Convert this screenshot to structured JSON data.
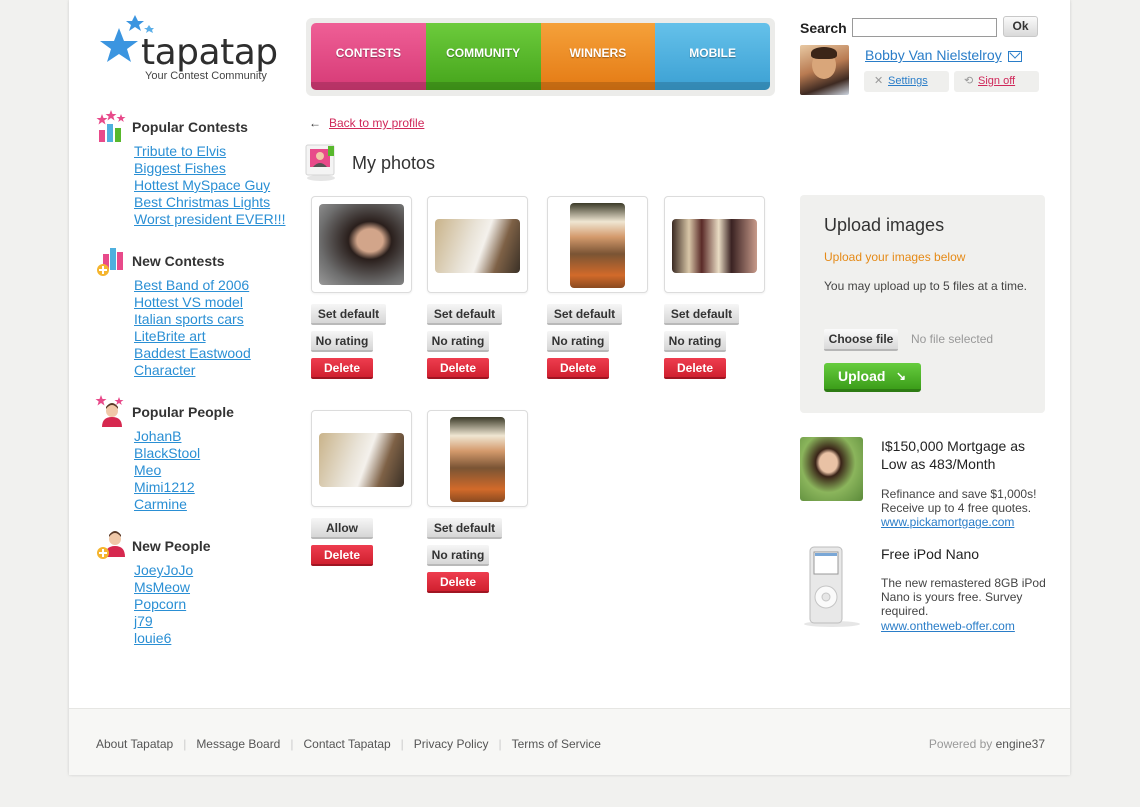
{
  "logo": {
    "word": "tapatap",
    "tagline": "Your Contest Community"
  },
  "nav": [
    {
      "label": "CONTESTS"
    },
    {
      "label": "COMMUNITY"
    },
    {
      "label": "WINNERS"
    },
    {
      "label": "MOBILE"
    }
  ],
  "search": {
    "label": "Search",
    "value": "",
    "button": "Ok"
  },
  "user": {
    "name": "Bobby Van Nielstelroy",
    "settings": "Settings",
    "sign_off": "Sign off"
  },
  "sidebar": {
    "popular_contests": {
      "title": "Popular Contests",
      "items": [
        "Tribute to Elvis",
        "Biggest Fishes",
        "Hottest MySpace Guy",
        "Best Christmas Lights",
        "Worst president EVER!!!"
      ]
    },
    "new_contests": {
      "title": "New Contests",
      "items": [
        "Best Band of 2006",
        "Hottest VS model",
        "Italian sports cars",
        "LiteBrite art",
        "Baddest Eastwood ",
        "Character"
      ]
    },
    "popular_people": {
      "title": "Popular People",
      "items": [
        "JohanB",
        "BlackStool",
        "Meo",
        "Mimi1212",
        "Carmine"
      ]
    },
    "new_people": {
      "title": "New People",
      "items": [
        "JoeyJoJo",
        "MsMeow",
        "Popcorn",
        "j79",
        "louie6"
      ]
    }
  },
  "main": {
    "back_arrow": "←",
    "back_link": "Back to my profile",
    "title": "My photos",
    "buttons": {
      "set_default": "Set default",
      "no_rating": "No rating",
      "delete": "Delete",
      "allow": "Allow"
    }
  },
  "upload": {
    "title": "Upload images",
    "subtitle": "Upload your images below",
    "description": "You may upload up to 5 files at a time.",
    "choose_file": "Choose file",
    "no_file": "No file selected",
    "upload_button": "Upload"
  },
  "ads": [
    {
      "title": "I$150,000 Mortgage as Low as 483/Month",
      "text": "Refinance and save $1,000s! Receive up to 4 free quotes.",
      "link": "www.pickamortgage.com"
    },
    {
      "title": "Free iPod Nano",
      "text": "The new remastered 8GB iPod Nano is yours free. Survey required.",
      "link": "www.ontheweb-offer.com"
    }
  ],
  "footer": {
    "links": [
      "About Tapatap",
      "Message Board",
      "Contact Tapatap",
      "Privacy Policy",
      "Terms of Service"
    ],
    "powered_prefix": "Powered by",
    "powered_brand": "engine37"
  },
  "colors": {
    "contests": "#e04a86",
    "community": "#58b82c",
    "winners": "#ec8d24",
    "mobile": "#4fb0de",
    "link": "#2a8fd4",
    "accent_pink": "#d0285a",
    "orange": "#e58a17",
    "upload_green": "#4fb22b",
    "delete_red": "#dc2a3a"
  }
}
